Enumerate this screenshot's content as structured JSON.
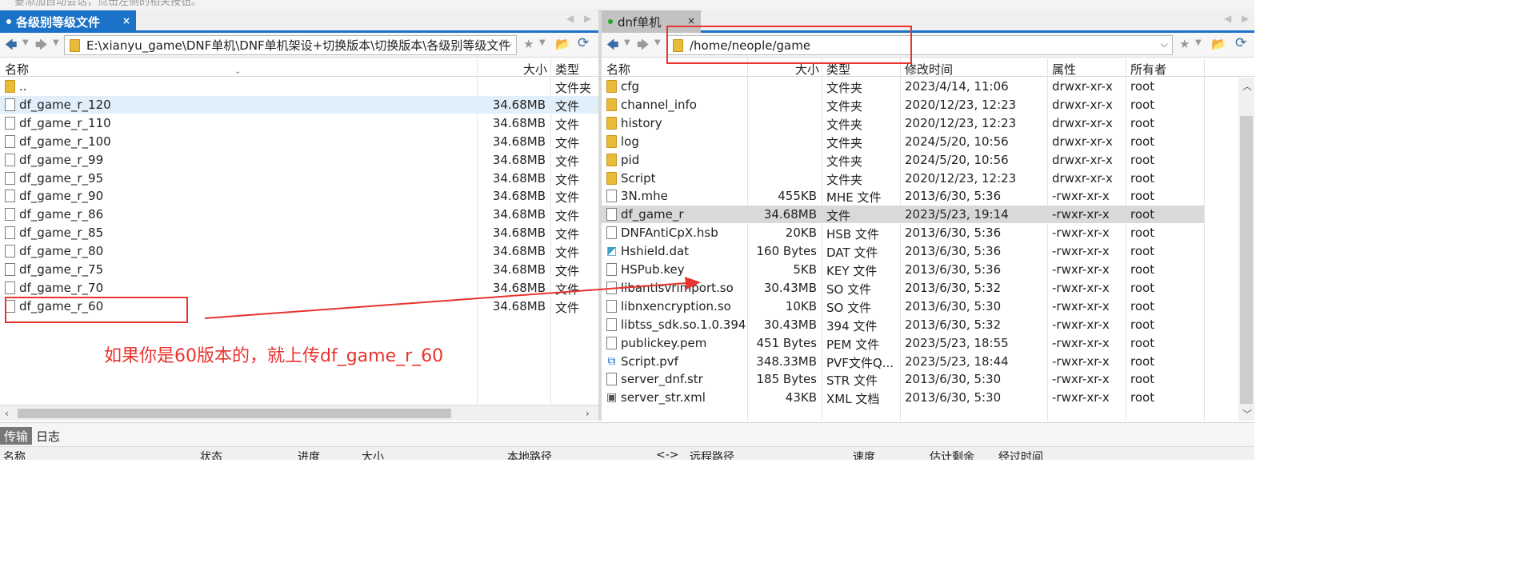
{
  "top_strip_text": "要添加自动会话，点击左侧的相关按钮。",
  "left": {
    "tab": {
      "title": "各级别等级文件",
      "close": "×"
    },
    "path": "E:\\xianyu_game\\DNF单机\\DNF单机架设+切换版本\\切换版本\\各级别等级文件",
    "headers": {
      "name": "名称",
      "size": "大小",
      "type": "类型"
    },
    "rows": [
      {
        "name": "..",
        "size": "",
        "type": "文件夹",
        "icon": "folder"
      },
      {
        "name": "df_game_r_120",
        "size": "34.68MB",
        "type": "文件",
        "icon": "file"
      },
      {
        "name": "df_game_r_110",
        "size": "34.68MB",
        "type": "文件",
        "icon": "file"
      },
      {
        "name": "df_game_r_100",
        "size": "34.68MB",
        "type": "文件",
        "icon": "file"
      },
      {
        "name": "df_game_r_99",
        "size": "34.68MB",
        "type": "文件",
        "icon": "file"
      },
      {
        "name": "df_game_r_95",
        "size": "34.68MB",
        "type": "文件",
        "icon": "file"
      },
      {
        "name": "df_game_r_90",
        "size": "34.68MB",
        "type": "文件",
        "icon": "file"
      },
      {
        "name": "df_game_r_86",
        "size": "34.68MB",
        "type": "文件",
        "icon": "file"
      },
      {
        "name": "df_game_r_85",
        "size": "34.68MB",
        "type": "文件",
        "icon": "file"
      },
      {
        "name": "df_game_r_80",
        "size": "34.68MB",
        "type": "文件",
        "icon": "file"
      },
      {
        "name": "df_game_r_75",
        "size": "34.68MB",
        "type": "文件",
        "icon": "file"
      },
      {
        "name": "df_game_r_70",
        "size": "34.68MB",
        "type": "文件",
        "icon": "file"
      },
      {
        "name": "df_game_r_60",
        "size": "34.68MB",
        "type": "文件",
        "icon": "file"
      }
    ]
  },
  "right": {
    "tab": {
      "title": "dnf单机",
      "close": "×"
    },
    "path": "/home/neople/game",
    "headers": {
      "name": "名称",
      "size": "大小",
      "type": "类型",
      "modified": "修改时间",
      "perms": "属性",
      "owner": "所有者"
    },
    "rows": [
      {
        "name": "cfg",
        "size": "",
        "type": "文件夹",
        "modified": "2023/4/14, 11:06",
        "perms": "drwxr-xr-x",
        "owner": "root",
        "icon": "folder"
      },
      {
        "name": "channel_info",
        "size": "",
        "type": "文件夹",
        "modified": "2020/12/23, 12:23",
        "perms": "drwxr-xr-x",
        "owner": "root",
        "icon": "folder"
      },
      {
        "name": "history",
        "size": "",
        "type": "文件夹",
        "modified": "2020/12/23, 12:23",
        "perms": "drwxr-xr-x",
        "owner": "root",
        "icon": "folder"
      },
      {
        "name": "log",
        "size": "",
        "type": "文件夹",
        "modified": "2024/5/20, 10:56",
        "perms": "drwxr-xr-x",
        "owner": "root",
        "icon": "folder"
      },
      {
        "name": "pid",
        "size": "",
        "type": "文件夹",
        "modified": "2024/5/20, 10:56",
        "perms": "drwxr-xr-x",
        "owner": "root",
        "icon": "folder"
      },
      {
        "name": "Script",
        "size": "",
        "type": "文件夹",
        "modified": "2020/12/23, 12:23",
        "perms": "drwxr-xr-x",
        "owner": "root",
        "icon": "folder"
      },
      {
        "name": "3N.mhe",
        "size": "455KB",
        "type": "MHE 文件",
        "modified": "2013/6/30, 5:36",
        "perms": "-rwxr-xr-x",
        "owner": "root",
        "icon": "file"
      },
      {
        "name": "df_game_r",
        "size": "34.68MB",
        "type": "文件",
        "modified": "2023/5/23, 19:14",
        "perms": "-rwxr-xr-x",
        "owner": "root",
        "icon": "file"
      },
      {
        "name": "DNFAntiCpX.hsb",
        "size": "20KB",
        "type": "HSB 文件",
        "modified": "2013/6/30, 5:36",
        "perms": "-rwxr-xr-x",
        "owner": "root",
        "icon": "file"
      },
      {
        "name": "Hshield.dat",
        "size": "160 Bytes",
        "type": "DAT 文件",
        "modified": "2013/6/30, 5:36",
        "perms": "-rwxr-xr-x",
        "owner": "root",
        "icon": "dat"
      },
      {
        "name": "HSPub.key",
        "size": "5KB",
        "type": "KEY 文件",
        "modified": "2013/6/30, 5:36",
        "perms": "-rwxr-xr-x",
        "owner": "root",
        "icon": "file"
      },
      {
        "name": "libantisvrimport.so",
        "size": "30.43MB",
        "type": "SO 文件",
        "modified": "2013/6/30, 5:32",
        "perms": "-rwxr-xr-x",
        "owner": "root",
        "icon": "file"
      },
      {
        "name": "libnxencryption.so",
        "size": "10KB",
        "type": "SO 文件",
        "modified": "2013/6/30, 5:30",
        "perms": "-rwxr-xr-x",
        "owner": "root",
        "icon": "file"
      },
      {
        "name": "libtss_sdk.so.1.0.394",
        "size": "30.43MB",
        "type": "394 文件",
        "modified": "2013/6/30, 5:32",
        "perms": "-rwxr-xr-x",
        "owner": "root",
        "icon": "file"
      },
      {
        "name": "publickey.pem",
        "size": "451 Bytes",
        "type": "PEM 文件",
        "modified": "2023/5/23, 18:55",
        "perms": "-rwxr-xr-x",
        "owner": "root",
        "icon": "file"
      },
      {
        "name": "Script.pvf",
        "size": "348.33MB",
        "type": "PVF文件Q...",
        "modified": "2023/5/23, 18:44",
        "perms": "-rwxr-xr-x",
        "owner": "root",
        "icon": "vscode"
      },
      {
        "name": "server_dnf.str",
        "size": "185 Bytes",
        "type": "STR 文件",
        "modified": "2013/6/30, 5:30",
        "perms": "-rwxr-xr-x",
        "owner": "root",
        "icon": "file"
      },
      {
        "name": "server_str.xml",
        "size": "43KB",
        "type": "XML 文档",
        "modified": "2013/6/30, 5:30",
        "perms": "-rwxr-xr-x",
        "owner": "root",
        "icon": "xml"
      }
    ]
  },
  "bottom": {
    "tabs": {
      "transfer": "传输",
      "log": "日志"
    },
    "headers": [
      "名称",
      "状态",
      "进度",
      "大小",
      "本地路径",
      "<->",
      "远程路径",
      "速度",
      "估计剩余",
      "经过时间"
    ]
  },
  "annotation": {
    "text": "如果你是60版本的，就上传df_game_r_60",
    "color": "#e8332e"
  },
  "colors": {
    "accent": "#1a73c8",
    "selection": "#e1effa",
    "annotation": "#e8332e"
  }
}
